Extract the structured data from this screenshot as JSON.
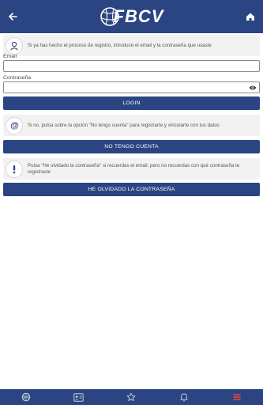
{
  "header": {
    "back_icon": "arrow-left-icon",
    "logo_text": "FBCV",
    "home_icon": "home-icon"
  },
  "intro": {
    "icon": "person-icon",
    "text": "Si ya has hecho el proceso de registro, introduce el email y la contraseña que usaste"
  },
  "form": {
    "email_label": "Email",
    "email_value": "",
    "password_label": "Contraseña",
    "password_value": "",
    "eye_icon": "eye-icon",
    "login_button": "LOGIN"
  },
  "register": {
    "icon": "at-icon",
    "text": "Si no, pulsa sobre la opción \"No tengo cuenta\" para registrarte y vincularte con tus datos",
    "button": "NO TENGO CUENTA"
  },
  "forgot": {
    "icon": "exclamation-icon",
    "text": "Pulsa \"He olvidado la contraseña\" si recuerdas el email, pero no recuerdas con qué contraseña te registraste",
    "button": "HE OLVIDADO LA CONTRASEÑA"
  },
  "bottom_nav": {
    "items": [
      "basketball-icon",
      "id-card-icon",
      "star-icon",
      "bell-icon",
      "menu-icon"
    ],
    "active_index": 4,
    "active_color": "#e8473a"
  },
  "colors": {
    "primary": "#2b4582",
    "card_bg": "#f2f2f2"
  }
}
